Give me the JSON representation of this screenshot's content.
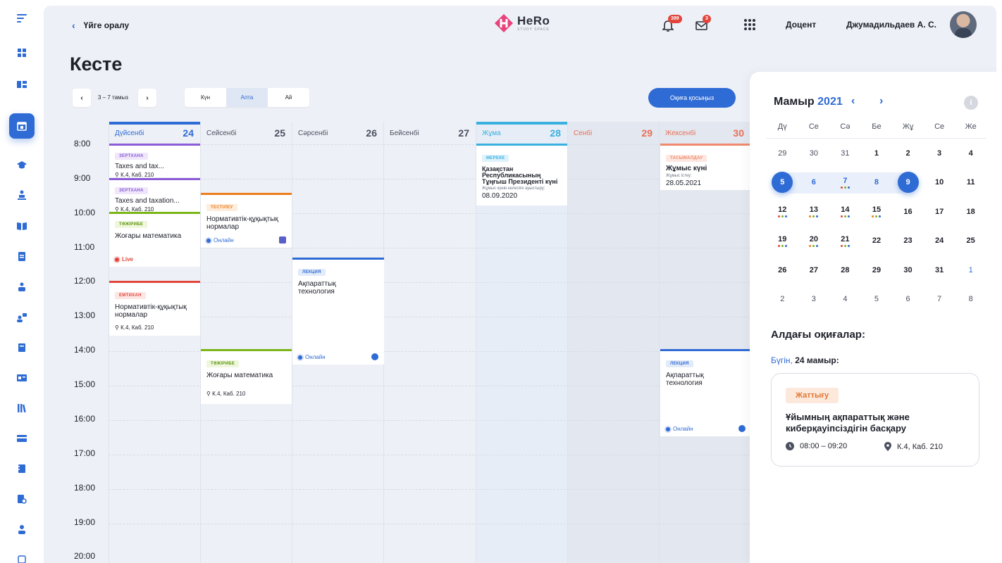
{
  "header": {
    "back_label": "Үйге оралу",
    "logo_name": "HeRo",
    "logo_sub": "STUDY SPACE",
    "notif_count": "399",
    "mail_count": "3",
    "role": "Доцент",
    "user_name": "Джумадильдаев А. С."
  },
  "page": {
    "title": "Кесте"
  },
  "toolbar": {
    "prev": "‹",
    "next": "›",
    "range": "3 – 7 тамыз",
    "views": [
      "Күн",
      "Апта",
      "Ай"
    ],
    "active_view": "Апта",
    "add_event": "Оқиға қосыңыз"
  },
  "times": [
    "8:00",
    "9:00",
    "10:00",
    "11:00",
    "12:00",
    "13:00",
    "14:00",
    "15:00",
    "16:00",
    "17:00",
    "18:00",
    "19:00",
    "20:00"
  ],
  "days": [
    {
      "name": "Дүйсенбі",
      "num": "24"
    },
    {
      "name": "Сейсенбі",
      "num": "25"
    },
    {
      "name": "Сәрсенбі",
      "num": "26"
    },
    {
      "name": "Бейсенбі",
      "num": "27"
    },
    {
      "name": "Жұма",
      "num": "28"
    },
    {
      "name": "Сенбі",
      "num": "29"
    },
    {
      "name": "Жексенбі",
      "num": "30"
    }
  ],
  "events": {
    "mon1": {
      "tag": "ЗЕРТХАНА",
      "title": "Taxes and tax...",
      "loc": "К.4, Каб. 210"
    },
    "mon2": {
      "tag": "ЗЕРТХАНА",
      "title": "Taxes and taxation...",
      "loc": "К.4, Каб. 210"
    },
    "mon3": {
      "tag": "ТӘЖІРИБЕ",
      "title": "Жоғары математика",
      "foot": "Live"
    },
    "mon4": {
      "tag": "ЕМТИХАН",
      "title": "Нормативтік-құқықтық нормалар",
      "loc": "К.4, Каб. 210"
    },
    "tue1": {
      "tag": "ТЕСТІЛЕУ",
      "title": "Нормативтік-құқықтық нормалар",
      "foot": "Онлайн"
    },
    "tue2": {
      "tag": "ТӘЖІРИБЕ",
      "title": "Жоғары математика",
      "loc": "К.4, Каб. 210"
    },
    "wed1": {
      "tag": "ЛЕКЦИЯ",
      "title": "Ақпараттық технология",
      "foot": "Онлайн"
    },
    "fri1": {
      "tag": "МЕРЕКЕ",
      "title": "Қазақстан Республикасының Тұңғыш Президенті күні",
      "note": "Жұмыс күнін келесіге ауыстыру:",
      "date": "08.09.2020"
    },
    "sun1": {
      "tag": "ТАСЫМАЛДАУ",
      "title": "Жұмыс күні",
      "note": "Жұмыс істеу:",
      "date": "28.05.2021"
    },
    "sun2": {
      "tag": "ЛЕКЦИЯ",
      "title": "Ақпараттық технология",
      "foot": "Онлайн"
    }
  },
  "mini_calendar": {
    "month": "Мамыр",
    "year": "2021",
    "weekdays": [
      "Дү",
      "Се",
      "Сә",
      "Бе",
      "Жұ",
      "Се",
      "Же"
    ],
    "weeks": [
      [
        "29",
        "30",
        "31",
        "1",
        "2",
        "3",
        "4"
      ],
      [
        "5",
        "6",
        "7",
        "8",
        "9",
        "10",
        "11"
      ],
      [
        "12",
        "13",
        "14",
        "15",
        "16",
        "17",
        "18"
      ],
      [
        "19",
        "20",
        "21",
        "22",
        "23",
        "24",
        "25"
      ],
      [
        "26",
        "27",
        "28",
        "29",
        "30",
        "31",
        "1"
      ],
      [
        "2",
        "3",
        "4",
        "5",
        "6",
        "7",
        "8"
      ]
    ]
  },
  "upcoming": {
    "title": "Алдағы оқиғалар:",
    "today_label": "Бүгін,",
    "date": "24 мамыр:",
    "card": {
      "tag": "Жаттығу",
      "title": "Ұйымның ақпараттық және киберқауіпсіздігін басқару",
      "time": "08:00 – 09:20",
      "loc": "К.4, Каб. 210"
    }
  },
  "colors": {
    "accent": "#2f6bd4",
    "lab": "#8b5cd6",
    "practice": "#7cb518",
    "exam": "#e2453c",
    "test": "#ee7d1e",
    "holiday": "#39b0e0",
    "transfer": "#ef8a6e"
  }
}
